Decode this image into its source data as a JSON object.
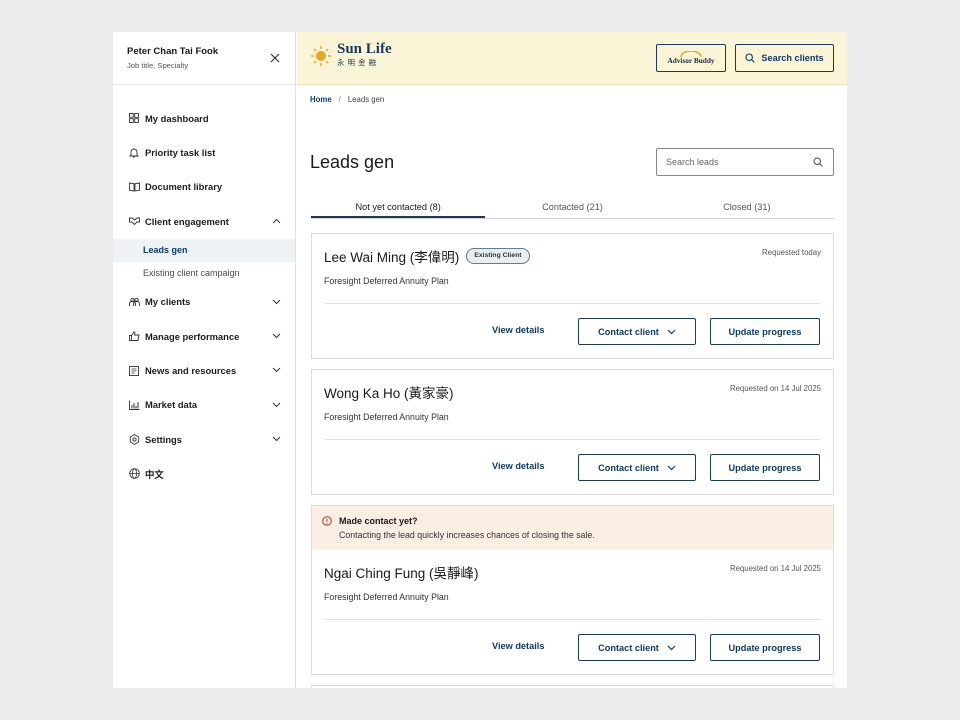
{
  "user": {
    "name": "Peter Chan Tai Fook",
    "subtitle": "Job title, Specialty"
  },
  "sidebar": {
    "items": [
      {
        "label": "My dashboard",
        "icon": "dashboard-icon"
      },
      {
        "label": "Priority task list",
        "icon": "bell-icon"
      },
      {
        "label": "Document library",
        "icon": "book-icon"
      },
      {
        "label": "Client engagement",
        "icon": "handshake-icon",
        "expanded": true,
        "children": [
          {
            "label": "Leads gen",
            "active": true
          },
          {
            "label": "Existing client campaign"
          }
        ]
      },
      {
        "label": "My clients",
        "icon": "people-icon"
      },
      {
        "label": "Manage performance",
        "icon": "thumbs-up-icon"
      },
      {
        "label": "News and resources",
        "icon": "news-icon"
      },
      {
        "label": "Market data",
        "icon": "bar-chart-icon"
      },
      {
        "label": "Settings",
        "icon": "gear-icon"
      },
      {
        "label": "中文",
        "icon": "globe-icon"
      }
    ]
  },
  "header": {
    "logo_main": "Sun Life",
    "logo_cn": "永明金融",
    "advisor_label": "Advisor Buddy",
    "search_clients_label": "Search clients"
  },
  "breadcrumb": {
    "home": "Home",
    "current": "Leads gen"
  },
  "page": {
    "title": "Leads gen",
    "search_placeholder": "Search leads"
  },
  "tabs": [
    {
      "label": "Not yet contacted (8)",
      "active": true
    },
    {
      "label": "Contacted (21)"
    },
    {
      "label": "Closed (31)"
    }
  ],
  "actions": {
    "view_details": "View details",
    "contact_client": "Contact client",
    "update_progress": "Update progress"
  },
  "alert": {
    "title": "Made contact yet?",
    "text": "Contacting the lead quickly increases chances of closing the sale."
  },
  "leads": [
    {
      "name": "Lee Wai Ming (李偉明)",
      "badge": "Existing Client",
      "requested": "Requested today",
      "plan": "Foresight Deferred Annuity Plan"
    },
    {
      "name": "Wong Ka Ho (黃家豪)",
      "requested": "Requested on 14 Jul 2025",
      "plan": "Foresight Deferred Annuity Plan"
    },
    {
      "name": "Ngai Ching Fung (吳靜峰)",
      "requested": "Requested on 14 Jul 2025",
      "plan": "Foresight Deferred Annuity Plan"
    }
  ],
  "colors": {
    "accent": "#0e3a68",
    "header_bg": "#fbf5d8",
    "alert_bg": "#fbefe4",
    "logo_gold": "#e5a823"
  }
}
